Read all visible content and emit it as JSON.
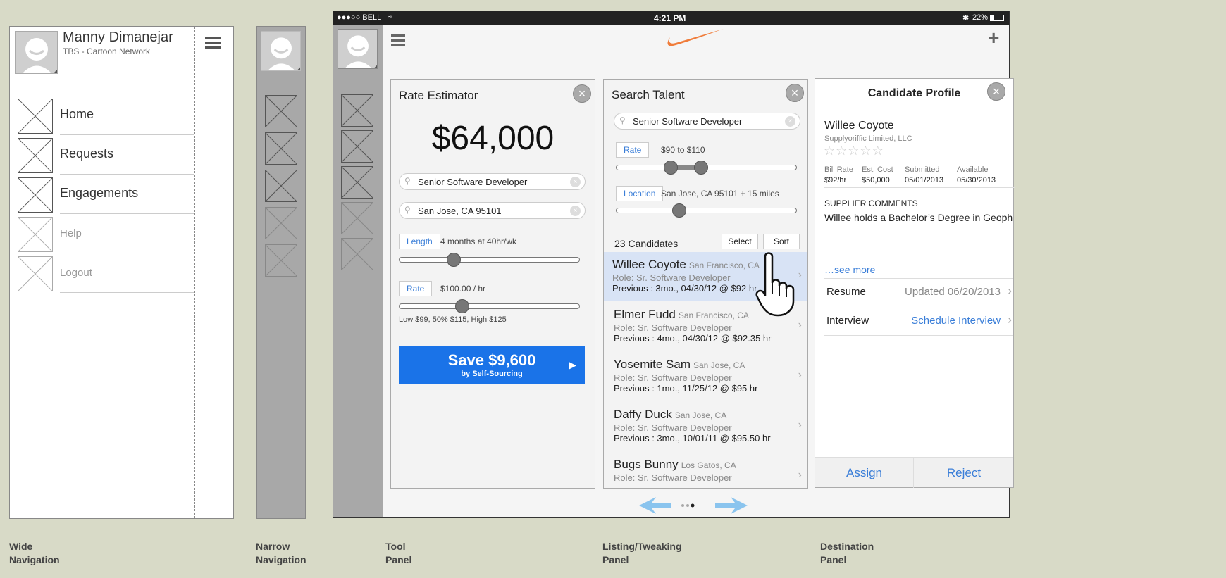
{
  "wide_nav": {
    "user_name": "Manny Dimanejar",
    "user_org": "TBS - Cartoon Network",
    "items": [
      {
        "label": "Home"
      },
      {
        "label": "Requests"
      },
      {
        "label": "Engagements"
      },
      {
        "label": "Help"
      },
      {
        "label": "Logout"
      }
    ]
  },
  "status_bar": {
    "carrier": "●●●○○ BELL",
    "time": "4:21 PM",
    "battery": "22%"
  },
  "rate_estimator": {
    "title": "Rate Estimator",
    "amount": "$64,000",
    "role_query": "Senior Software Developer",
    "location_query": "San Jose, CA 95101",
    "length_label": "Length",
    "length_value": "4 months at 40hr/wk",
    "rate_label": "Rate",
    "rate_value": "$100.00 / hr",
    "rate_range": "Low $99, 50% $115, High $125",
    "length_slider": 0.3,
    "rate_slider": 0.35,
    "save_main": "Save $9,600",
    "save_sub": "by Self-Sourcing"
  },
  "search_talent": {
    "title": "Search Talent",
    "query": "Senior Software Developer",
    "rate_label": "Rate",
    "rate_value": "$90 to $110",
    "rate_slider": [
      0.3,
      0.47
    ],
    "location_label": "Location",
    "location_value": "San Jose, CA 95101 + 15 miles",
    "location_slider": 0.35,
    "count": "23 Candidates",
    "select_label": "Select",
    "sort_label": "Sort",
    "candidates": [
      {
        "name": "Willee Coyote",
        "loc": "San Francisco, CA",
        "role": "Role:  Sr. Software Developer",
        "prev_label": "Previous",
        "prev": " : 3mo., 04/30/12 @ $92 hr",
        "selected": true
      },
      {
        "name": "Elmer Fudd",
        "loc": "San Francisco, CA",
        "role": "Role:  Sr. Software Developer",
        "prev_label": "Previous",
        "prev": " : 4mo., 04/30/12 @ $92.35 hr"
      },
      {
        "name": "Yosemite Sam",
        "loc": "San Jose, CA",
        "role": "Role:  Sr. Software Developer",
        "prev_label": "Previous",
        "prev": " : 1mo., 11/25/12 @ $95 hr"
      },
      {
        "name": "Daffy Duck",
        "loc": "San Jose, CA",
        "role": "Role:  Sr. Software Developer",
        "prev_label": "Previous",
        "prev": " : 3mo., 10/01/11 @ $95.50 hr"
      },
      {
        "name": "Bugs Bunny",
        "loc": "Los Gatos, CA",
        "role": "Role:  Sr. Software Developer",
        "prev_label": "Previous",
        "prev": ""
      }
    ]
  },
  "candidate_profile": {
    "title": "Candidate Profile",
    "name": "Willee Coyote",
    "company": "Supplyoriffic Limited, LLC",
    "rating": 0,
    "bill_rate_label": "Bill Rate",
    "bill_rate": "$92/hr",
    "est_cost_label": "Est. Cost",
    "est_cost": "$50,000",
    "submitted_label": "Submitted",
    "submitted": "05/01/2013",
    "available_label": "Available",
    "available": "05/30/2013",
    "comments_heading": "SUPPLIER COMMENTS",
    "comments": "Willee holds a Bachelor’s Degree in Geophysical Science from the University of Chicago. He recently completed a seasonal project at Lash Group as a Reimbursement Counselor. He has experience contacting insurance companies and investigating patient’s benefits. According to his professional mentor, he has had a stellar record of delivering before time and under budget",
    "see_more": "…see more",
    "resume_label": "Resume",
    "resume_value": "Updated 06/20/2013",
    "interview_label": "Interview",
    "interview_value": "Schedule Interview",
    "assign_label": "Assign",
    "reject_label": "Reject"
  },
  "captions": {
    "wide": "Wide\nNavigation",
    "narrow": "Narrow\nNavigation",
    "tool": "Tool\nPanel",
    "listing": "Listing/Tweaking\nPanel",
    "destination": "Destination\nPanel"
  },
  "colors": {
    "accent": "#3a7ed8",
    "save_button": "#1a73e8",
    "nike": "#f07c3a",
    "arrow": "#8ac4ee",
    "selected_row": "#d8e3f5"
  }
}
